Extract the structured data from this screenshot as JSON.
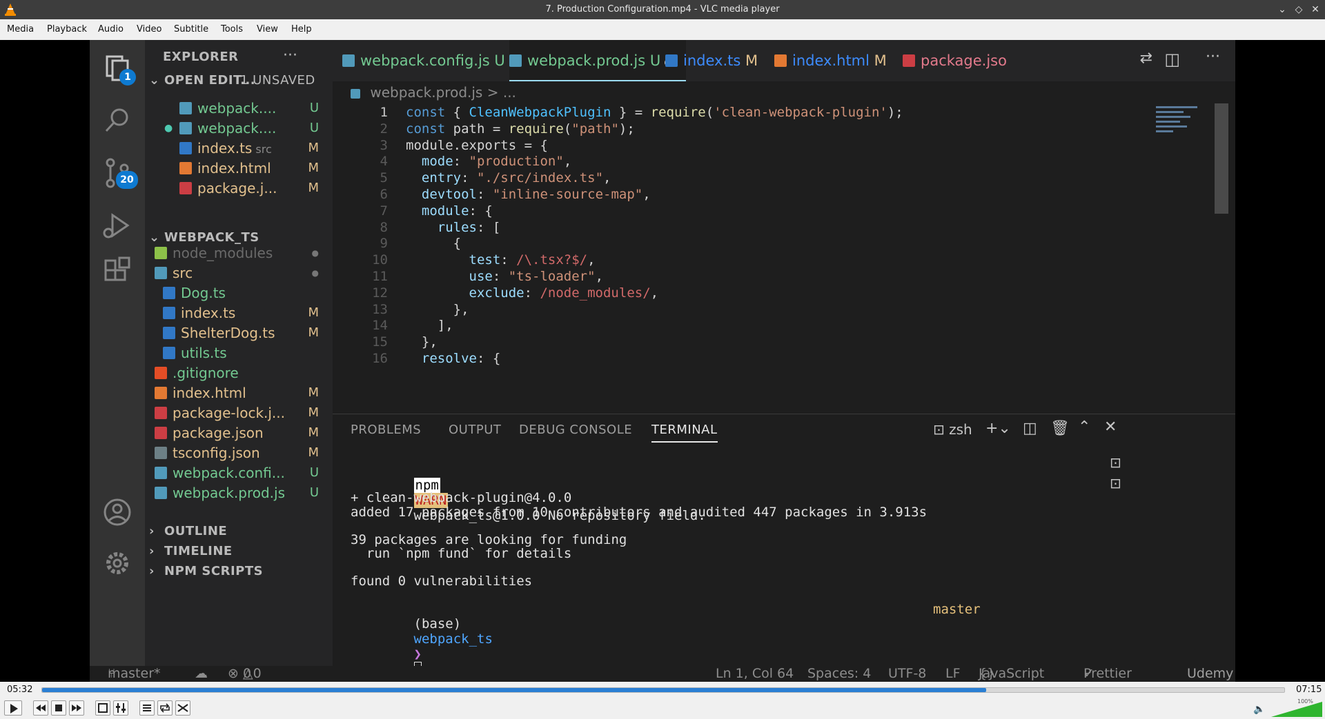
{
  "window": {
    "title": "7. Production Configuration.mp4 - VLC media player"
  },
  "menu": [
    "Media",
    "Playback",
    "Audio",
    "Video",
    "Subtitle",
    "Tools",
    "View",
    "Help"
  ],
  "vscode": {
    "explorer_title": "EXPLORER",
    "activity_badges": {
      "explorer": "1",
      "scm": "20"
    },
    "open_editors": {
      "label": "OPEN EDIT...",
      "unsaved": "1 UNSAVED",
      "items": [
        {
          "name": "webpack....",
          "status": "U",
          "color": "#519aba",
          "dot": false
        },
        {
          "name": "webpack....",
          "status": "U",
          "color": "#519aba",
          "dot": true
        },
        {
          "name": "index.ts",
          "extra": "src",
          "status": "M",
          "color": "#3178c6",
          "dot": false
        },
        {
          "name": "index.html",
          "status": "M",
          "color": "#e37933",
          "dot": false
        },
        {
          "name": "package.j...",
          "status": "M",
          "color": "#cc3e44",
          "dot": false
        }
      ]
    },
    "project": {
      "label": "WEBPACK_TS",
      "items": [
        {
          "name": "node_modules",
          "status": "●",
          "indent": 0,
          "color": "#8dc149"
        },
        {
          "name": "src",
          "status": "●",
          "indent": 0,
          "color": "#519aba"
        },
        {
          "name": "Dog.ts",
          "status": "",
          "indent": 1,
          "color": "#3178c6"
        },
        {
          "name": "index.ts",
          "status": "M",
          "indent": 1,
          "color": "#3178c6"
        },
        {
          "name": "ShelterDog.ts",
          "status": "M",
          "indent": 1,
          "color": "#3178c6"
        },
        {
          "name": "utils.ts",
          "status": "",
          "indent": 1,
          "color": "#3178c6"
        },
        {
          "name": ".gitignore",
          "status": "",
          "indent": 0,
          "color": "#e44d26"
        },
        {
          "name": "index.html",
          "status": "M",
          "indent": 0,
          "color": "#e37933"
        },
        {
          "name": "package-lock.j...",
          "status": "M",
          "indent": 0,
          "color": "#cc3e44"
        },
        {
          "name": "package.json",
          "status": "M",
          "indent": 0,
          "color": "#cc3e44"
        },
        {
          "name": "tsconfig.json",
          "status": "M",
          "indent": 0,
          "color": "#6d8086"
        },
        {
          "name": "webpack.confi...",
          "status": "U",
          "indent": 0,
          "color": "#519aba"
        },
        {
          "name": "webpack.prod.js",
          "status": "U",
          "indent": 0,
          "color": "#519aba"
        }
      ]
    },
    "sections": [
      "OUTLINE",
      "TIMELINE",
      "NPM SCRIPTS"
    ],
    "tabs": [
      {
        "name": "webpack.config.js",
        "status": "U",
        "color": "#519aba"
      },
      {
        "name": "webpack.prod.js",
        "status": "U",
        "color": "#519aba"
      },
      {
        "name": "index.ts",
        "status": "M",
        "color": "#3178c6"
      },
      {
        "name": "index.html",
        "status": "M",
        "color": "#e37933"
      },
      {
        "name": "package.jso",
        "status": "",
        "color": "#cc3e44"
      }
    ],
    "breadcrumb": {
      "file": "webpack.prod.js",
      "rest": "> ..."
    },
    "code_lines": [
      {
        "n": "1",
        "text": "const { CleanWebpackPlugin } = require('clean-webpack-plugin');"
      },
      {
        "n": "2",
        "text": "const path = require(\"path\");"
      },
      {
        "n": "3",
        "text": "module.exports = {"
      },
      {
        "n": "4",
        "text": "  mode: \"production\","
      },
      {
        "n": "5",
        "text": "  entry: \"./src/index.ts\","
      },
      {
        "n": "6",
        "text": "  devtool: \"inline-source-map\","
      },
      {
        "n": "7",
        "text": "  module: {"
      },
      {
        "n": "8",
        "text": "    rules: ["
      },
      {
        "n": "9",
        "text": "      {"
      },
      {
        "n": "10",
        "text": "        test: /\\.tsx?$/,"
      },
      {
        "n": "11",
        "text": "        use: \"ts-loader\","
      },
      {
        "n": "12",
        "text": "        exclude: /node_modules/,"
      },
      {
        "n": "13",
        "text": "      },"
      },
      {
        "n": "14",
        "text": "    ],"
      },
      {
        "n": "15",
        "text": "  },"
      },
      {
        "n": "16",
        "text": "  resolve: {"
      }
    ],
    "panel_tabs": [
      "PROBLEMS",
      "OUTPUT",
      "DEBUG CONSOLE",
      "TERMINAL"
    ],
    "shell": "zsh",
    "terminal": {
      "warn_prefix": "npm",
      "warn_tag": "WARN",
      "warn_text": "webpack_ts@1.0.0 No repository field.",
      "lines": [
        "+ clean-webpack-plugin@4.0.0",
        "added 17 packages from 10 contributors and audited 447 packages in 3.913s",
        "",
        "39 packages are looking for funding",
        "  run `npm fund` for details",
        "",
        "found 0 vulnerabilities"
      ],
      "prompt_env": "(base)",
      "prompt_dir": "webpack_ts",
      "prompt_arrow": "❯",
      "branch": "master"
    },
    "status": {
      "branch": "master*",
      "errors": "0",
      "warnings": "0",
      "position": "Ln 1, Col 64",
      "spaces": "Spaces: 4",
      "encoding": "UTF-8",
      "eol": "LF",
      "language": "JavaScript",
      "formatter": "Prettier",
      "watermark": "Udemy"
    }
  },
  "player": {
    "elapsed": "05:32",
    "total": "07:15",
    "progress": 0.76,
    "volume_label": "100%",
    "volume": 1.0
  }
}
